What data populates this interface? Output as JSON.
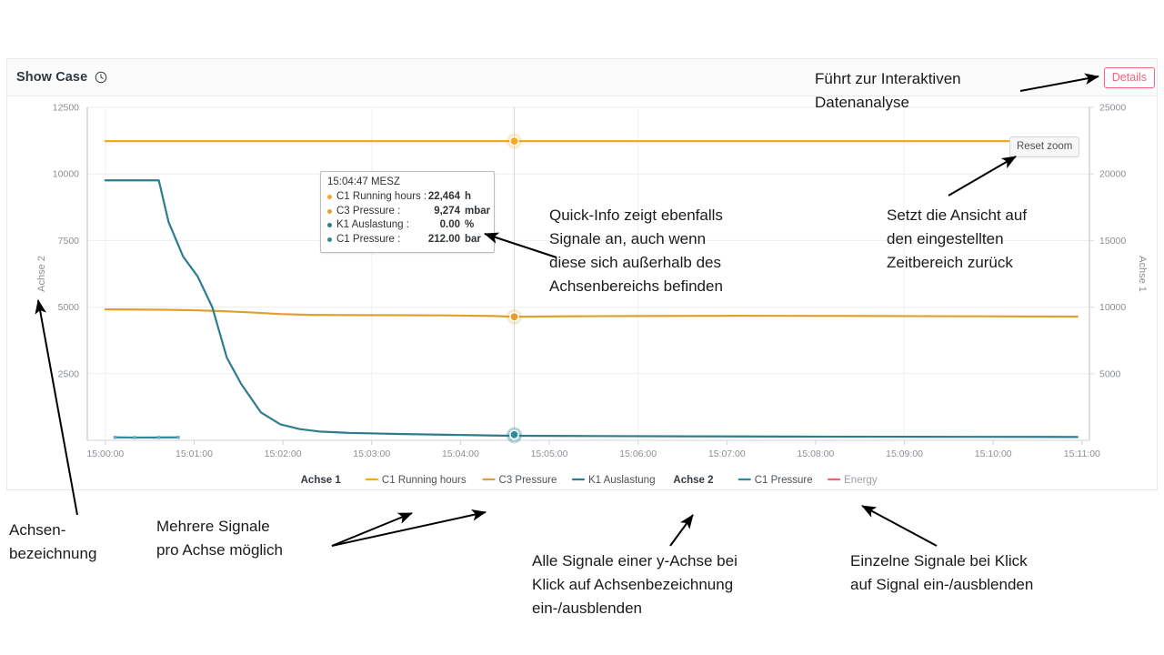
{
  "header": {
    "title": "Show Case",
    "clock_icon": "clock-icon",
    "details_label": "Details",
    "details_color": "#f4647c"
  },
  "chart_controls": {
    "reset_zoom_label": "Reset zoom"
  },
  "tooltip": {
    "time": "15:04:47 MESZ",
    "rows": [
      {
        "name": "C1 Running hours :",
        "value": "22,464",
        "unit": "h",
        "color": "#f5a623"
      },
      {
        "name": "C3 Pressure :",
        "value": "9,274",
        "unit": "mbar",
        "color": "#e0a030"
      },
      {
        "name": "K1 Auslastung :",
        "value": "0.00",
        "unit": "%",
        "color": "#2e7d8f"
      },
      {
        "name": "C1 Pressure :",
        "value": "212.00",
        "unit": "bar",
        "color": "#2e8b9b"
      }
    ]
  },
  "annotations": [
    {
      "id": "anno-details",
      "text": "Führt zur Interaktiven\nDatenanalyse"
    },
    {
      "id": "anno-quickinfo",
      "text": "Quick-Info zeigt ebenfalls\nSignale an, auch wenn\ndiese sich außerhalb des\nAchsenbereichs befinden"
    },
    {
      "id": "anno-resetzoom",
      "text": "Setzt die Ansicht auf\nden eingestellten\nZeitbereich zurück"
    },
    {
      "id": "anno-axis-label",
      "text": "Achsen-\nbezeichnung"
    },
    {
      "id": "anno-multi-signal",
      "text": "Mehrere Signale\npro Achse möglich"
    },
    {
      "id": "anno-axis-toggle",
      "text": "Alle Signale einer y-Achse bei\nKlick auf Achsenbezeichnung\nein-/ausblenden"
    },
    {
      "id": "anno-signal-toggle",
      "text": "Einzelne Signale bei Klick\nauf Signal ein-/ausblenden"
    }
  ],
  "chart_data": {
    "type": "line",
    "title": "Show Case",
    "xlabel": "",
    "grid": true,
    "legend_position": "bottom",
    "x_tick_labels": [
      "15:00:00",
      "15:01:00",
      "15:02:00",
      "15:03:00",
      "15:04:00",
      "15:05:00",
      "15:06:00",
      "15:07:00",
      "15:08:00",
      "15:09:00",
      "15:10:00",
      "15:11:00"
    ],
    "axes": [
      {
        "id": "left",
        "name": "Achse 2",
        "position": "left",
        "ticks": [
          2500,
          5000,
          7500,
          10000,
          12500
        ],
        "tick_labels": [
          "2500",
          "5000",
          "7500",
          "10000",
          "12500"
        ],
        "ylim": [
          0,
          12500
        ]
      },
      {
        "id": "right",
        "name": "Achse 1",
        "position": "right",
        "ticks": [
          5000,
          10000,
          15000,
          20000,
          25000
        ],
        "tick_labels": [
          "5000",
          "10000",
          "15000",
          "20000",
          "25000"
        ],
        "ylim": [
          0,
          25000
        ]
      }
    ],
    "crosshair": {
      "x_label": "15:04:47 MESZ",
      "x_fraction": 0.4207
    },
    "series": [
      {
        "name": "C1 Running hours",
        "axis": "right",
        "color": "#f5a623",
        "visible": true,
        "legend_group": "Achse 1",
        "x": [
          0,
          0.05,
          0.1,
          0.15,
          0.2,
          0.25,
          0.3,
          0.35,
          0.4,
          0.4207,
          0.45,
          0.5,
          0.55,
          0.6,
          0.65,
          0.7,
          0.75,
          0.8,
          0.85,
          0.9,
          0.95,
          1.0
        ],
        "values": [
          22464,
          22464,
          22464,
          22464,
          22464,
          22464,
          22464,
          22464,
          22464,
          22464,
          22464,
          22464,
          22464,
          22464,
          22464,
          22464,
          22464,
          22464,
          22464,
          22464,
          22464,
          22464
        ],
        "marker_value_at_crosshair": 22464
      },
      {
        "name": "C3 Pressure",
        "axis": "right",
        "color": "#e0a030",
        "visible": true,
        "legend_group": "Achse 1",
        "x": [
          0,
          0.03,
          0.06,
          0.09,
          0.12,
          0.15,
          0.18,
          0.21,
          0.25,
          0.3,
          0.35,
          0.4,
          0.4207,
          0.45,
          0.5,
          0.55,
          0.6,
          0.65,
          0.7,
          0.75,
          0.8,
          0.85,
          0.9,
          0.95,
          1.0
        ],
        "values": [
          9830,
          9820,
          9800,
          9770,
          9700,
          9600,
          9480,
          9420,
          9400,
          9390,
          9380,
          9330,
          9274,
          9300,
          9320,
          9330,
          9340,
          9350,
          9345,
          9340,
          9330,
          9320,
          9310,
          9300,
          9290
        ],
        "marker_value_at_crosshair": 9274
      },
      {
        "name": "K1 Auslastung",
        "axis": "left",
        "color": "#2e7d8f",
        "visible": true,
        "legend_group": "Achse 1",
        "x": [
          0,
          0.02,
          0.04,
          0.055,
          0.065,
          0.08,
          0.095,
          0.11,
          0.125,
          0.14,
          0.16,
          0.18,
          0.2,
          0.22,
          0.25,
          0.3,
          0.35,
          0.4,
          0.4207,
          0.5,
          0.6,
          0.7,
          0.8,
          0.9,
          1.0
        ],
        "values": [
          9760,
          9760,
          9760,
          9760,
          8200,
          6900,
          6150,
          5000,
          3100,
          2100,
          1050,
          600,
          420,
          330,
          280,
          240,
          210,
          180,
          170,
          160,
          150,
          140,
          135,
          130,
          125
        ],
        "marker_value_at_crosshair": 170
      },
      {
        "name": "C1 Pressure",
        "axis": "left",
        "color": "#2e8b9b",
        "visible": true,
        "legend_group": "Achse 2",
        "x": [
          0.01,
          0.03,
          0.055,
          0.075
        ],
        "values": [
          110,
          105,
          108,
          112
        ],
        "marker_value_at_crosshair": 212
      },
      {
        "name": "Energy",
        "axis": "left",
        "color": "#f0607a",
        "visible": false,
        "legend_group": "Achse 2",
        "x": [],
        "values": []
      }
    ],
    "legend": [
      {
        "type": "axis-label",
        "label": "Achse 1"
      },
      {
        "type": "series",
        "label": "C1 Running hours",
        "color": "#f5a623",
        "visible": true
      },
      {
        "type": "series",
        "label": "C3 Pressure",
        "color": "#e0a030",
        "visible": true
      },
      {
        "type": "series",
        "label": "K1 Auslastung",
        "color": "#2e7d8f",
        "visible": true
      },
      {
        "type": "axis-label",
        "label": "Achse 2"
      },
      {
        "type": "series",
        "label": "C1 Pressure",
        "color": "#2e8b9b",
        "visible": true
      },
      {
        "type": "series",
        "label": "Energy",
        "color": "#f0607a",
        "visible": false
      }
    ]
  }
}
